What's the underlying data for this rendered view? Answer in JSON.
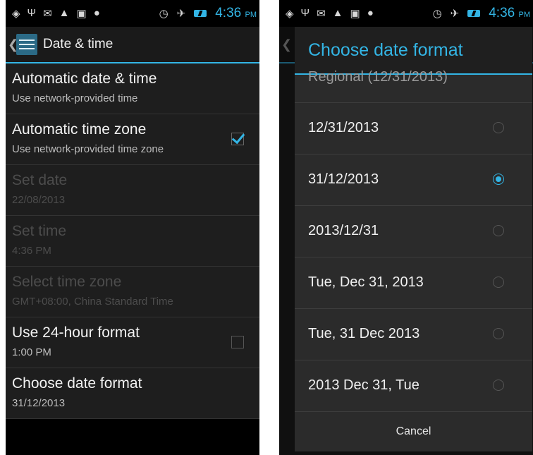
{
  "status_bar": {
    "time": "4:36",
    "ampm": "PM",
    "left_icons": [
      "gps-icon",
      "usb-icon",
      "gmail-icon",
      "warning-icon",
      "chat-icon",
      "android-icon"
    ],
    "right_icons": [
      "alarm-icon",
      "airplane-icon",
      "battery-charging-icon"
    ],
    "accent_color": "#33b5e5"
  },
  "left_screen": {
    "action_bar": {
      "title": "Date & time",
      "back_glyph": "❮"
    },
    "preferences": [
      {
        "title": "Automatic date & time",
        "summary": "Use network-provided time",
        "enabled": true,
        "checkbox": null
      },
      {
        "title": "Automatic time zone",
        "summary": "Use network-provided time zone",
        "enabled": true,
        "checkbox": "checked"
      },
      {
        "title": "Set date",
        "summary": "22/08/2013",
        "enabled": false,
        "checkbox": null
      },
      {
        "title": "Set time",
        "summary": "4:36 PM",
        "enabled": false,
        "checkbox": null
      },
      {
        "title": "Select time zone",
        "summary": "GMT+08:00, China Standard Time",
        "enabled": false,
        "checkbox": null
      },
      {
        "title": "Use 24-hour format",
        "summary": "1:00 PM",
        "enabled": true,
        "checkbox": "unchecked"
      },
      {
        "title": "Choose date format",
        "summary": "31/12/2013",
        "enabled": true,
        "checkbox": null
      }
    ]
  },
  "right_screen": {
    "back_glyph": "❮",
    "dialog": {
      "title": "Choose date format",
      "partial_option": "Regional (12/31/2013)",
      "options": [
        {
          "label": "12/31/2013",
          "selected": false
        },
        {
          "label": "31/12/2013",
          "selected": true
        },
        {
          "label": "2013/12/31",
          "selected": false
        },
        {
          "label": "Tue, Dec 31, 2013",
          "selected": false
        },
        {
          "label": "Tue, 31 Dec 2013",
          "selected": false
        },
        {
          "label": "2013 Dec 31, Tue",
          "selected": false
        }
      ],
      "cancel_label": "Cancel"
    }
  }
}
